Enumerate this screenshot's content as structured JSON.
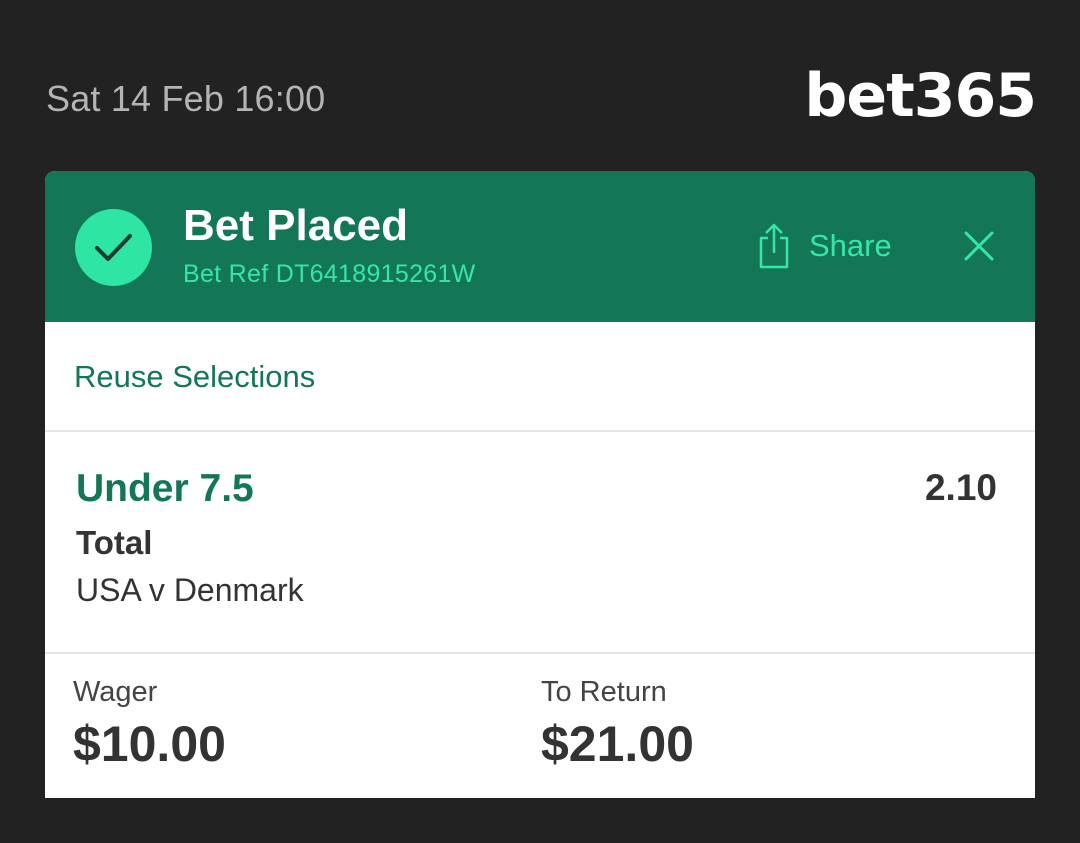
{
  "header": {
    "datetime": "Sat 14 Feb 16:00",
    "logo_text": "bet365"
  },
  "confirmation": {
    "title": "Bet Placed",
    "bet_ref": "Bet Ref DT6418915261W",
    "share_label": "Share",
    "icons": {
      "status": "check-icon",
      "share": "share-icon",
      "close": "close-icon"
    }
  },
  "reuse": {
    "label": "Reuse Selections"
  },
  "selection": {
    "name": "Under 7.5",
    "odds": "2.10",
    "market": "Total",
    "event": "USA v Denmark"
  },
  "summary": {
    "wager_label": "Wager",
    "wager_value": "$10.00",
    "return_label": "To Return",
    "return_value": "$21.00"
  },
  "colors": {
    "background": "#222222",
    "brand_green": "#137656",
    "accent_green": "#36e6a6",
    "check_circle": "#2ee5a4"
  }
}
